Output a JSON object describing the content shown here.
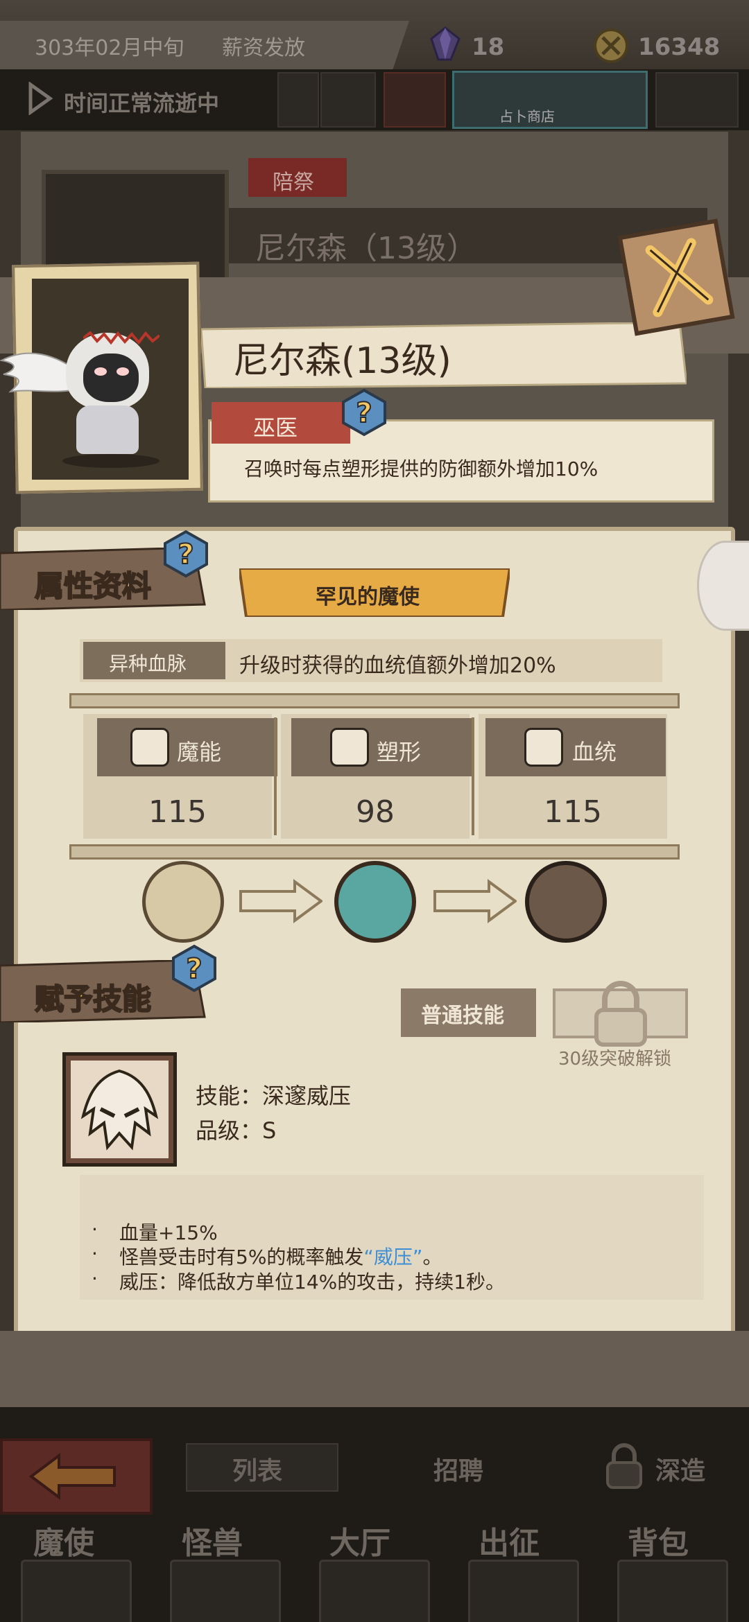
{
  "status_bar": {
    "date": "303年02月中旬",
    "event": "薪资发放",
    "gems": "18",
    "coins": "16348"
  },
  "time_bar": {
    "status": "时间正常流逝中",
    "shop_label": "占卜商店"
  },
  "background_card": {
    "tag": "陪祭",
    "name": "尼尔森（13级）"
  },
  "hero": {
    "name": "尼尔森(13级)",
    "class_label": "巫医",
    "class_desc": "召唤时每点塑形提供的防御额外增加10%"
  },
  "attributes": {
    "section_title": "属性资料",
    "rarity": "罕见的魔使",
    "trait_label": "异种血脉",
    "trait_desc": "升级时获得的血统值额外增加20%",
    "stats": [
      {
        "label": "魔能",
        "value": "115"
      },
      {
        "label": "塑形",
        "value": "98"
      },
      {
        "label": "血统",
        "value": "115"
      }
    ]
  },
  "skills": {
    "section_title": "赋予技能",
    "type_label": "普通技能",
    "lock_text": "30级突破解锁",
    "skill_name": "技能：深邃威压",
    "skill_grade": "品级：S",
    "desc": [
      {
        "text": "血量+15%"
      },
      {
        "before": "怪兽受击时有5%的概率触发",
        "highlight": "“威压”",
        "after": "。"
      },
      {
        "text": "威压：降低敌方单位14%的攻击，持续1秒。"
      }
    ]
  },
  "bottom": {
    "tab_list": "列表",
    "tab_recruit": "招聘",
    "tab_deep": "深造",
    "nav": [
      "魔使",
      "怪兽",
      "大厅",
      "出征",
      "背包"
    ]
  },
  "colors": {
    "accent_gold": "#f1b64a",
    "class_red": "#b34a3e",
    "highlight_blue": "#3e8ed6",
    "parchment": "#e8dfc8"
  }
}
